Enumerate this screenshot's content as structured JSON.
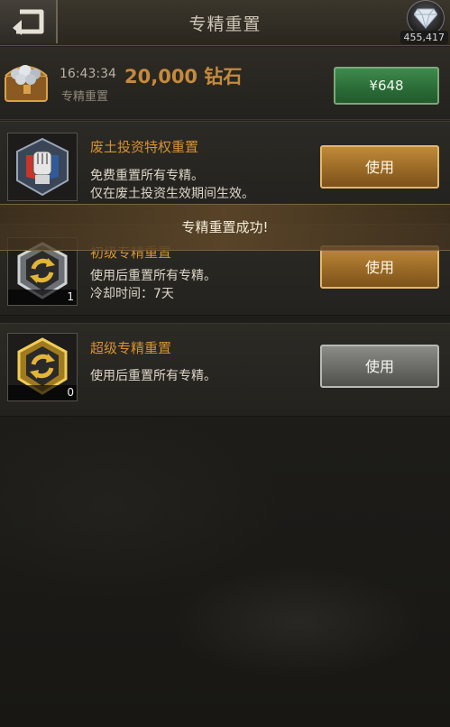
{
  "header": {
    "title": "专精重置",
    "back_icon": "back-arrow-icon",
    "diamond_icon": "diamond-icon",
    "diamond_amount": "455,417"
  },
  "offer": {
    "icon": "treasure-chest-icon",
    "time": "16:43:34",
    "amount": "20,000 钻石",
    "subtitle": "专精重置",
    "price_label": "¥648",
    "price_color": "#2f7a3f"
  },
  "items": [
    {
      "icon": "fist-emblem-icon",
      "title": "废土投资特权重置",
      "desc_line1": "免费重置所有专精。",
      "desc_line2": "仅在废土投资生效期间生效。",
      "count": "",
      "button_label": "使用",
      "button_style": "gold"
    },
    {
      "icon": "silver-reset-badge-icon",
      "title": "初级专精重置",
      "desc_line1": "使用后重置所有专精。",
      "desc_line2": "冷却时间：7天",
      "count": "1",
      "button_label": "使用",
      "button_style": "gold"
    },
    {
      "icon": "gold-reset-badge-icon",
      "title": "超级专精重置",
      "desc_line1": "使用后重置所有专精。",
      "desc_line2": "",
      "count": "0",
      "button_label": "使用",
      "button_style": "gray"
    }
  ],
  "toast": {
    "message": "专精重置成功!"
  },
  "colors": {
    "title_orange": "#d6912f",
    "gold_button": "#9a6a26",
    "gray_button": "#6a6a67"
  }
}
